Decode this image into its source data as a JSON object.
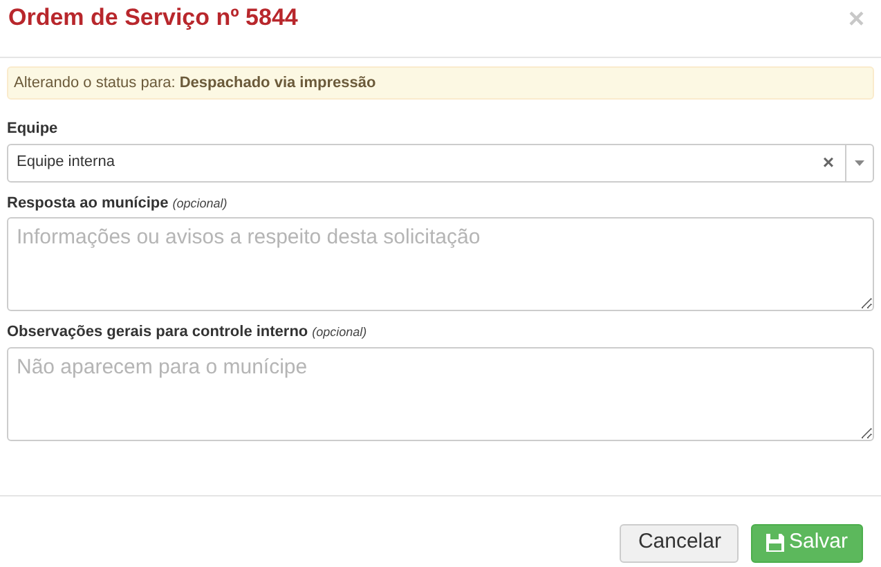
{
  "dialog": {
    "title": "Ordem de Serviço nº 5844",
    "close": "×"
  },
  "alert": {
    "prefix": "Alterando o status para:",
    "status": "Despachado via impressão"
  },
  "team": {
    "label": "Equipe",
    "value": "Equipe interna",
    "clear": "×"
  },
  "fields": [
    {
      "label": "Resposta ao munícipe",
      "hint": "(opcional)",
      "placeholder": "Informações ou avisos a respeito desta solicitação"
    },
    {
      "label": "Observações gerais para controle interno",
      "hint": "(opcional)",
      "placeholder": "Não aparecem para o munícipe"
    }
  ],
  "buttons": [
    {
      "label": "Cancelar",
      "kind": "default"
    },
    {
      "label": "Salvar",
      "kind": "primary"
    }
  ]
}
